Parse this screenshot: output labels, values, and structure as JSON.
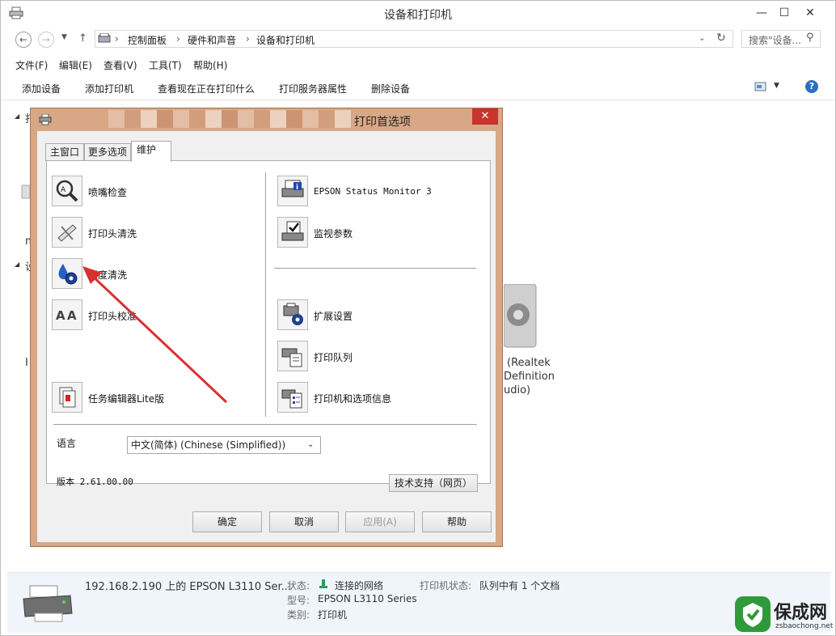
{
  "window": {
    "title": "设备和打印机",
    "minimize": "—",
    "maximize": "☐",
    "close": "✕"
  },
  "address": {
    "breadcrumb": [
      "控制面板",
      "硬件和声音",
      "设备和打印机"
    ],
    "separator": "›",
    "search_placeholder": "搜索\"设备..."
  },
  "menu": [
    "文件(F)",
    "编辑(E)",
    "查看(V)",
    "工具(T)",
    "帮助(H)"
  ],
  "commands": [
    "添加设备",
    "添加打印机",
    "查看现在正在打印什么",
    "打印服务器属性",
    "删除设备"
  ],
  "content_fragments": {
    "group1_letter": "打",
    "group2_letter": "设",
    "item_m": "m",
    "item_i": "I",
    "audio_line1": "(Realtek",
    "audio_line2": "Definition",
    "audio_line3": "udio)"
  },
  "status": {
    "printer_name": "192.168.2.190 上的 EPSON L3110 Ser...",
    "state_label": "状态:",
    "state_value": "连接的网络",
    "printer_state_label": "打印机状态:",
    "printer_state_value": "队列中有 1 个文档",
    "model_label": "型号:",
    "model_value": "EPSON L3110 Series",
    "category_label": "类别:",
    "category_value": "打印机"
  },
  "dialog": {
    "title": "打印首选项",
    "tabs": [
      "主窗口",
      "更多选项",
      "维护"
    ],
    "active_tab": "维护",
    "left_items": [
      "喷嘴检查",
      "打印头清洗",
      "深度清洗",
      "打印头校准",
      "任务编辑器Lite版"
    ],
    "right_items": [
      "EPSON Status Monitor 3",
      "监视参数",
      "扩展设置",
      "打印队列",
      "打印机和选项信息"
    ],
    "language_label": "语言",
    "language_value": "中文(简体) (Chinese (Simplified))",
    "version_text": "版本 2.61.00.00",
    "support_button": "技术支持（网页）",
    "ok": "确定",
    "cancel": "取消",
    "apply": "应用(A)",
    "help": "帮助"
  },
  "watermark": {
    "brand": "保成网",
    "url": "zsbaochong.net"
  },
  "colors": {
    "dialog_frame": "#d8a785",
    "close_red": "#c7352c",
    "arrow_red": "#d93030",
    "status_bg": "#f0f5fb"
  }
}
